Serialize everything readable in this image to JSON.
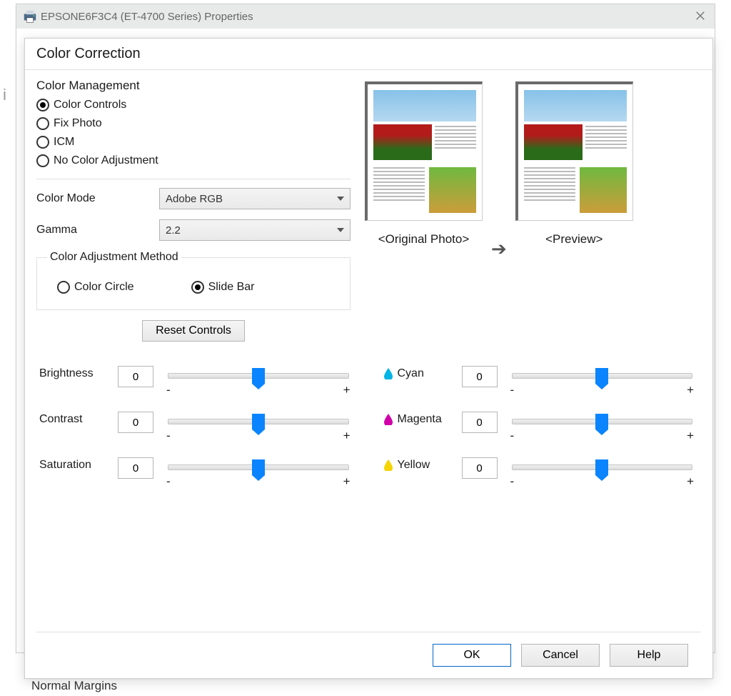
{
  "window": {
    "title": "EPSONE6F3C4 (ET-4700 Series) Properties"
  },
  "dialog": {
    "title": "Color Correction"
  },
  "color_management": {
    "label": "Color Management",
    "options": {
      "controls": "Color Controls",
      "fix_photo": "Fix Photo",
      "icm": "ICM",
      "none": "No Color Adjustment"
    },
    "selected": "controls"
  },
  "color_mode": {
    "label": "Color Mode",
    "value": "Adobe RGB"
  },
  "gamma": {
    "label": "Gamma",
    "value": "2.2"
  },
  "adjustment_method": {
    "label": "Color Adjustment Method",
    "options": {
      "circle": "Color Circle",
      "slider": "Slide Bar"
    },
    "selected": "slider"
  },
  "reset_label": "Reset Controls",
  "previews": {
    "original_label": "<Original Photo>",
    "preview_label": "<Preview>"
  },
  "sliders": {
    "brightness": {
      "label": "Brightness",
      "value": "0",
      "minus": "-",
      "plus": "+"
    },
    "contrast": {
      "label": "Contrast",
      "value": "0",
      "minus": "-",
      "plus": "+"
    },
    "saturation": {
      "label": "Saturation",
      "value": "0",
      "minus": "-",
      "plus": "+"
    },
    "cyan": {
      "label": "Cyan",
      "value": "0",
      "minus": "-",
      "plus": "+"
    },
    "magenta": {
      "label": "Magenta",
      "value": "0",
      "minus": "-",
      "plus": "+"
    },
    "yellow": {
      "label": "Yellow",
      "value": "0",
      "minus": "-",
      "plus": "+"
    }
  },
  "buttons": {
    "ok": "OK",
    "cancel": "Cancel",
    "help": "Help"
  },
  "background_hints": {
    "normal_margins": "Normal Margins"
  }
}
